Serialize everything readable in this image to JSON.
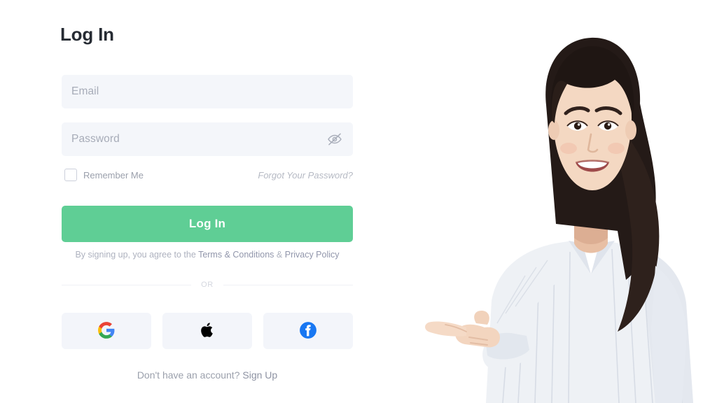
{
  "page": {
    "title": "Log In",
    "background_color": "#ffffff"
  },
  "form": {
    "email": {
      "placeholder": "Email",
      "value": ""
    },
    "password": {
      "placeholder": "Password",
      "value": "",
      "toggle_icon": "eye-off-icon",
      "visible": false
    },
    "remember_me": {
      "label": "Remember Me",
      "checked": false
    },
    "forgot_password_label": "Forgot Your Password?",
    "submit_label": "Log In",
    "submit_color": "#5fce95",
    "field_background": "#f4f6fa"
  },
  "terms": {
    "prefix": "By signing up, you agree to the ",
    "terms_link": "Terms & Conditions",
    "separator": " & ",
    "privacy_link": "Privacy Policy"
  },
  "divider": {
    "label": "OR"
  },
  "social": {
    "buttons": [
      {
        "name": "google",
        "icon": "google-icon",
        "color": "#4285F4"
      },
      {
        "name": "apple",
        "icon": "apple-icon",
        "color": "#000000"
      },
      {
        "name": "facebook",
        "icon": "facebook-icon",
        "color": "#1877F2"
      }
    ]
  },
  "signup": {
    "prompt": "Don't have an account? ",
    "link": "Sign Up"
  },
  "photo": {
    "description": "smiling-woman-pointing-left",
    "shirt_color": "#eef1f5",
    "hair_color": "#2a1f1c",
    "skin_color": "#f2d4bd"
  }
}
